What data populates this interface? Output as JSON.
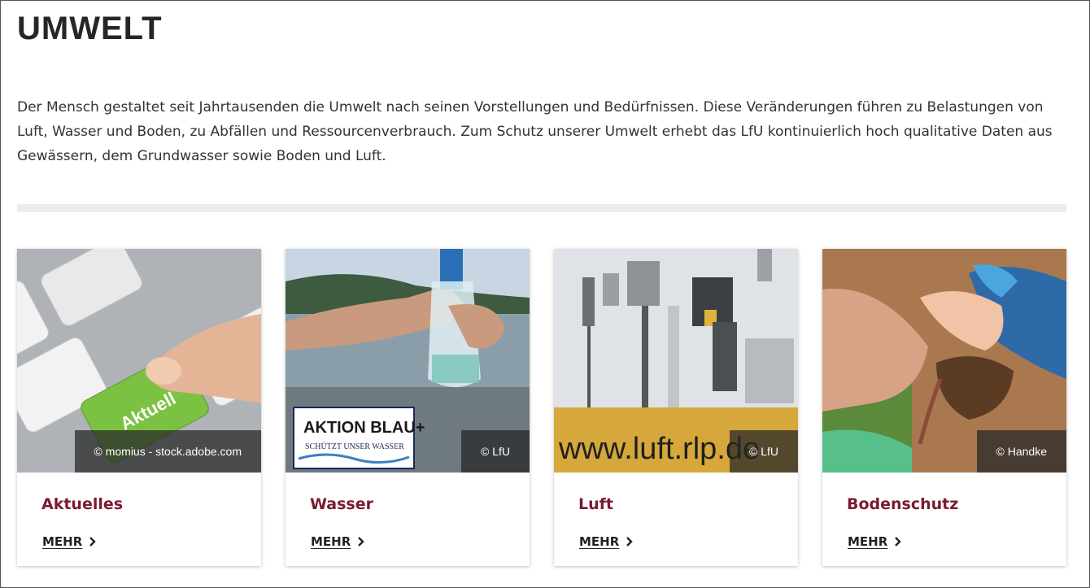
{
  "page": {
    "title": "UMWELT",
    "intro": "Der Mensch gestaltet seit Jahrtausenden die Umwelt nach seinen Vorstellungen und Bedürfnissen. Diese Veränderungen führen zu Belastungen von Luft, Wasser und Boden, zu Abfällen und Ressourcenverbrauch. Zum Schutz unserer Umwelt erhebt das LfU kontinuierlich hoch qualitative Daten aus Gewässern, dem Grundwasser sowie Boden und Luft."
  },
  "cards": [
    {
      "title": "Aktuelles",
      "credit": "© momius - stock.adobe.com",
      "more": "MEHR",
      "key_label": "Aktuell",
      "icon": "chevron-right-icon"
    },
    {
      "title": "Wasser",
      "credit": "© LfU",
      "more": "MEHR",
      "logo_main": "AKTION BLAU+",
      "logo_sub": "SCHÜTZT UNSER WASSER",
      "icon": "chevron-right-icon"
    },
    {
      "title": "Luft",
      "credit": "© LfU",
      "more": "MEHR",
      "sign_text": "www.luft.rlp.de",
      "icon": "chevron-right-icon"
    },
    {
      "title": "Bodenschutz",
      "credit": "© Handke",
      "more": "MEHR",
      "icon": "chevron-right-icon"
    }
  ],
  "colors": {
    "accent": "#7a1a30",
    "divider": "#ececec",
    "green_key": "#7cc242"
  }
}
